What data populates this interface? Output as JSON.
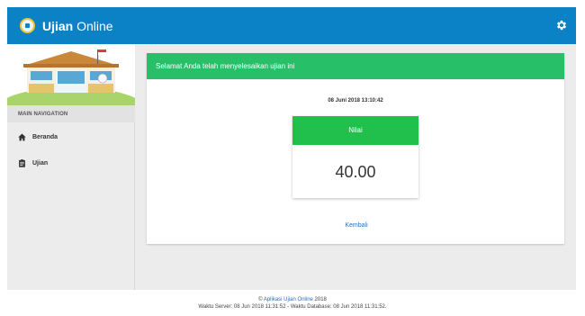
{
  "header": {
    "brand_bold": "Ujian",
    "brand_rest": " Online",
    "settings_icon": "gear-icon",
    "color": "#0c82c6"
  },
  "sidebar": {
    "nav_header": "MAIN NAVIGATION",
    "items": [
      {
        "label": "Beranda",
        "icon": "home-icon"
      },
      {
        "label": "Ujian",
        "icon": "clipboard-icon"
      }
    ]
  },
  "main": {
    "alert": "Selamat Anda telah menyelesaikan ujian ini",
    "alert_color": "#27c069",
    "datetime": "08 Juni 2018 13:10:42",
    "score_label": "Nilai",
    "score_value": "40.00",
    "back_link": "Kembali"
  },
  "footer": {
    "copyright_symbol": "©",
    "link_text": "Aplikasi Ujian Online",
    "year": "2018",
    "server_time": "Waktu Server: 08 Jun 2018 11:31:52 - Waktu Database: 08 Jun 2018 11:31:52."
  }
}
